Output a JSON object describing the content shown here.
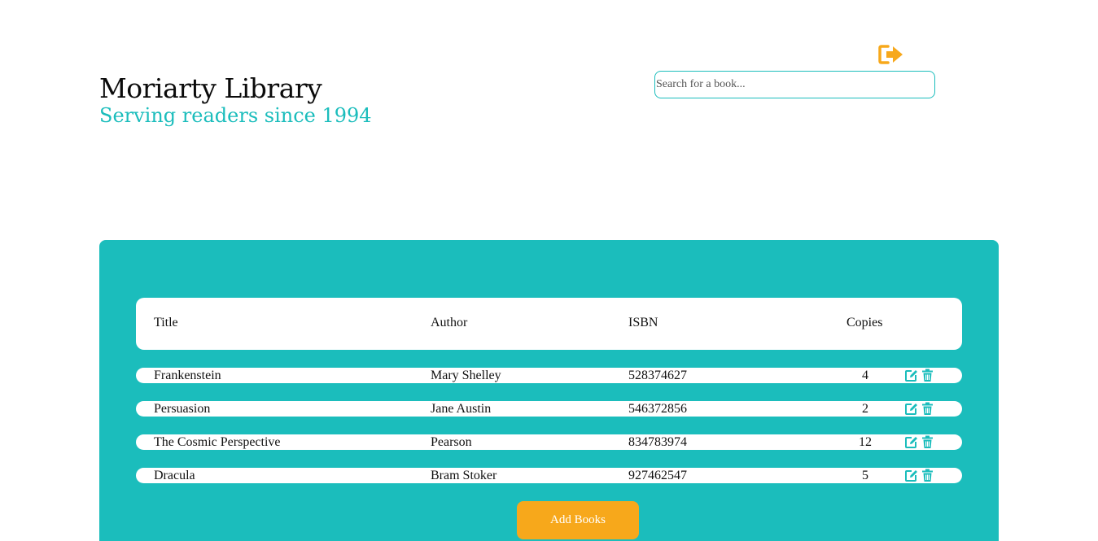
{
  "header": {
    "title": "Moriarty Library",
    "subtitle": "Serving readers since 1994",
    "logout_icon": "sign-out-icon"
  },
  "search": {
    "placeholder": "Search for a book...",
    "value": ""
  },
  "table": {
    "columns": [
      "Title",
      "Author",
      "ISBN",
      "Copies"
    ],
    "rows": [
      {
        "title": "Frankenstein",
        "author": "Mary Shelley",
        "isbn": "528374627",
        "copies": "4"
      },
      {
        "title": "Persuasion",
        "author": "Jane Austin",
        "isbn": "546372856",
        "copies": "2"
      },
      {
        "title": "The Cosmic Perspective",
        "author": "Pearson",
        "isbn": "834783974",
        "copies": "12"
      },
      {
        "title": "Dracula",
        "author": "Bram Stoker",
        "isbn": "927462547",
        "copies": "5"
      }
    ],
    "row_action_icons": [
      "edit-icon",
      "trash-icon"
    ]
  },
  "add_button": {
    "label": "Add Books"
  },
  "colors": {
    "accent": "#1bbdbc",
    "button": "#f7a81b"
  }
}
